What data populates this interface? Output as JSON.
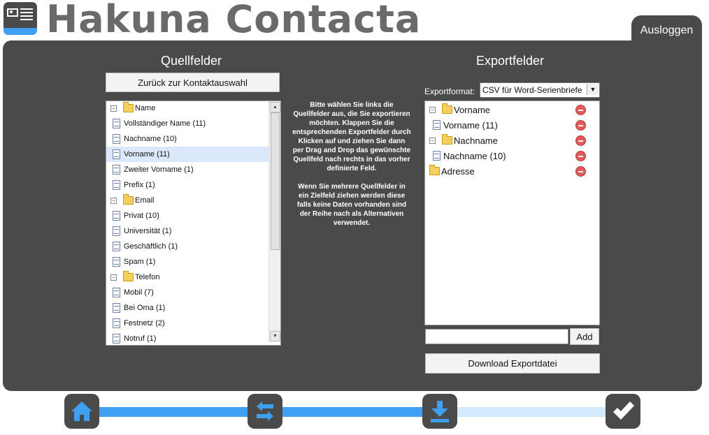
{
  "app": {
    "title": "Hakuna Contacta",
    "logout_label": "Ausloggen"
  },
  "source": {
    "heading": "Quellfelder",
    "back_button": "Zurück zur Kontaktauswahl",
    "tree": [
      {
        "type": "folder",
        "label": "Name",
        "expander": "−"
      },
      {
        "type": "item",
        "label": "Vollständiger Name (11)"
      },
      {
        "type": "item",
        "label": "Nachname (10)"
      },
      {
        "type": "item",
        "label": "Vorname (11)",
        "selected": true
      },
      {
        "type": "item",
        "label": "Zweiter Vorname (1)"
      },
      {
        "type": "item",
        "label": "Prefix (1)"
      },
      {
        "type": "folder",
        "label": "Email",
        "expander": "−"
      },
      {
        "type": "item",
        "label": "Privat (10)"
      },
      {
        "type": "item",
        "label": "Universität (1)"
      },
      {
        "type": "item",
        "label": "Geschäftlich (1)"
      },
      {
        "type": "item",
        "label": "Spam (1)"
      },
      {
        "type": "folder",
        "label": "Telefon",
        "expander": "−"
      },
      {
        "type": "item",
        "label": "Mobil (7)"
      },
      {
        "type": "item",
        "label": "Bei Oma (1)"
      },
      {
        "type": "item",
        "label": "Festnetz (2)"
      },
      {
        "type": "item",
        "label": "Notruf (1)"
      }
    ]
  },
  "instructions": {
    "p1": "Bitte wählen Sie links die Quellfelder aus, die Sie exportieren möchten. Klappen Sie die entsprechenden Exportfelder durch Klicken auf und ziehen Sie dann per Drag and Drop das gewünschte Quellfeld nach rechts in das vorher definierte Feld.",
    "p2": "Wenn Sie mehrere Quellfelder in ein Zielfeld ziehen werden diese falls keine Daten vorhanden sind der Reihe nach als Alternativen verwendet."
  },
  "export": {
    "heading": "Exportfelder",
    "format_label": "Exportformat:",
    "format_value": "CSV für Word-Serienbriefe",
    "tree": [
      {
        "type": "folder",
        "label": "Vorname",
        "expander": "−",
        "depth": 0
      },
      {
        "type": "item",
        "label": "Vorname (11)",
        "depth": 1
      },
      {
        "type": "folder",
        "label": "Nachname",
        "expander": "−",
        "depth": 0
      },
      {
        "type": "item",
        "label": "Nachname (10)",
        "depth": 1
      },
      {
        "type": "folder",
        "label": "Adresse",
        "depth": 0
      }
    ],
    "new_field_value": "",
    "add_button": "Add",
    "download_button": "Download Exportdatei"
  },
  "steps": {
    "items": [
      {
        "name": "home",
        "icon": "home-icon"
      },
      {
        "name": "mapping",
        "icon": "swap-arrows-icon"
      },
      {
        "name": "download",
        "icon": "download-icon"
      },
      {
        "name": "done",
        "icon": "checkmark-icon"
      }
    ],
    "current_step": 3,
    "total_steps": 4,
    "colors": {
      "done": "#3fa0f2",
      "pending": "#d4e9fb",
      "accent": "#3fa0f2",
      "dark": "#4a4a4a"
    }
  }
}
